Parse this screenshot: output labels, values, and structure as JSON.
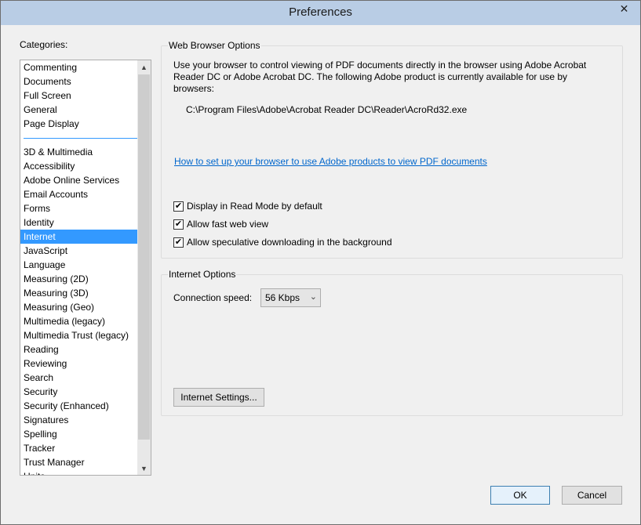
{
  "window": {
    "title": "Preferences",
    "close_symbol": "✕"
  },
  "categories": {
    "label": "Categories:",
    "group1": [
      "Commenting",
      "Documents",
      "Full Screen",
      "General",
      "Page Display"
    ],
    "group2": [
      "3D & Multimedia",
      "Accessibility",
      "Adobe Online Services",
      "Email Accounts",
      "Forms",
      "Identity",
      "Internet",
      "JavaScript",
      "Language",
      "Measuring (2D)",
      "Measuring (3D)",
      "Measuring (Geo)",
      "Multimedia (legacy)",
      "Multimedia Trust (legacy)",
      "Reading",
      "Reviewing",
      "Search",
      "Security",
      "Security (Enhanced)",
      "Signatures",
      "Spelling",
      "Tracker",
      "Trust Manager",
      "Units"
    ],
    "selected": "Internet"
  },
  "web_browser_options": {
    "title": "Web Browser Options",
    "description": "Use your browser to control viewing of PDF documents directly in the browser using Adobe Acrobat Reader DC or Adobe Acrobat DC. The following Adobe product is currently available for use by browsers:",
    "path": "C:\\Program Files\\Adobe\\Acrobat Reader DC\\Reader\\AcroRd32.exe",
    "link": "How to set up your browser to use Adobe products to view PDF documents",
    "checkboxes": [
      {
        "label": "Display in Read Mode by default",
        "checked": true
      },
      {
        "label": "Allow fast web view",
        "checked": true
      },
      {
        "label": "Allow speculative downloading in the background",
        "checked": true
      }
    ]
  },
  "internet_options": {
    "title": "Internet Options",
    "connection_label": "Connection speed:",
    "connection_value": "56 Kbps",
    "settings_button": "Internet Settings..."
  },
  "footer": {
    "ok": "OK",
    "cancel": "Cancel"
  }
}
